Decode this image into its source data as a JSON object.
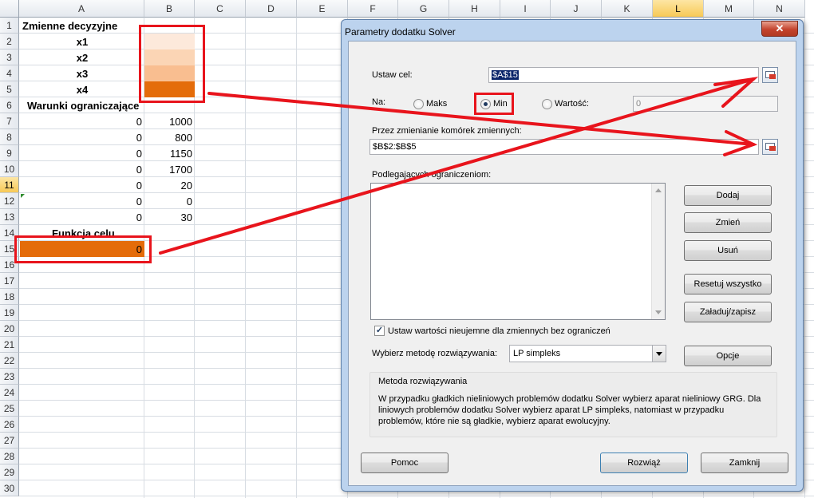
{
  "sheet": {
    "columns": [
      "A",
      "B",
      "C",
      "D",
      "E",
      "F",
      "G",
      "H",
      "I",
      "J",
      "K",
      "L",
      "M",
      "N"
    ],
    "selected_column": "L",
    "rows": [
      "1",
      "2",
      "3",
      "4",
      "5",
      "6",
      "7",
      "8",
      "9",
      "10",
      "11",
      "12",
      "13",
      "14",
      "15",
      "16",
      "17",
      "18",
      "19",
      "20",
      "21",
      "22",
      "23",
      "24",
      "25",
      "26",
      "27",
      "28",
      "29",
      "30"
    ],
    "selected_row": "11",
    "cells": {
      "a1": "Zmienne decyzyjne",
      "a2": "x1",
      "a3": "x2",
      "a4": "x3",
      "a5": "x4",
      "a6": "Warunki ograniczające",
      "a7": "0",
      "b7": "1000",
      "a8": "0",
      "b8": "800",
      "a9": "0",
      "b9": "1150",
      "a10": "0",
      "b10": "1700",
      "a11": "0",
      "b11": "20",
      "a12": "0",
      "b12": "0",
      "a13": "0",
      "b13": "30",
      "a14": "Funkcja celu",
      "a15": "0"
    },
    "colors": {
      "b2": "#fde9db",
      "b3": "#fbd5b5",
      "b4": "#f9be90",
      "b5": "#e46c0a",
      "a15": "#e46c0a",
      "annotation": "#e8141c"
    }
  },
  "dialog": {
    "title": "Parametry dodatku Solver",
    "close_label": "✕",
    "set_objective_label": "Ustaw cel:",
    "set_objective_value": "$A$15",
    "to_label": "Na:",
    "radio_max": "Maks",
    "radio_min": "Min",
    "radio_value": "Wartość:",
    "value_of_field": "0",
    "selected_radio": "Min",
    "changing_cells_label": "Przez zmienianie komórek zmiennych:",
    "changing_cells_value": "$B$2:$B$5",
    "constraints_label": "Podlegających ograniczeniom:",
    "btn_add": "Dodaj",
    "btn_change": "Zmień",
    "btn_delete": "Usuń",
    "btn_reset": "Resetuj wszystko",
    "btn_load_save": "Załaduj/zapisz",
    "nonneg_label": "Ustaw wartości nieujemne dla zmiennych bez ograniczeń",
    "nonneg_checked": true,
    "method_label": "Wybierz metodę rozwiązywania:",
    "method_value": "LP simpleks",
    "btn_options": "Opcje",
    "method_group_title": "Metoda rozwiązywania",
    "method_description": "W przypadku gładkich nieliniowych problemów dodatku Solver wybierz aparat nieliniowy GRG. Dla liniowych problemów dodatku Solver wybierz aparat LP simpleks, natomiast w przypadku problemów, które nie są gładkie, wybierz aparat ewolucyjny.",
    "btn_help": "Pomoc",
    "btn_solve": "Rozwiąż",
    "btn_close": "Zamknij"
  }
}
